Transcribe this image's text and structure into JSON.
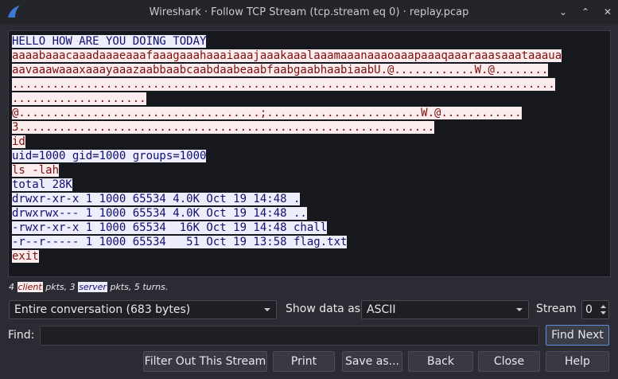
{
  "window": {
    "title": "Wireshark · Follow TCP Stream (tcp.stream eq 0) · replay.pcap",
    "buttons": [
      "⌄",
      "⌃",
      "✕"
    ]
  },
  "stream": {
    "lines": [
      {
        "dir": "server",
        "text": "HELLO HOW ARE YOU DOING TODAY"
      },
      {
        "dir": "client",
        "text": "aaaabaaacaaadaaaeaaafaaagaaahaaaiaaajaaakaaalaaamaaanaaaoaaapaaaqaaaraaasaaataaaua"
      },
      {
        "dir": "client",
        "text": "aavaaawaaaxaaayaaazaabbaabcaabdaabeaabfaabgaabhaabiaabU.@............W.@........"
      },
      {
        "dir": "client",
        "text": "................................................................................."
      },
      {
        "dir": "client",
        "text": "...................."
      },
      {
        "dir": "client",
        "text": "@....................................;.......................W.@............"
      },
      {
        "dir": "client",
        "text": "3.............................................................."
      },
      {
        "dir": "client",
        "text": "id"
      },
      {
        "dir": "server",
        "text": "uid=1000 gid=1000 groups=1000"
      },
      {
        "dir": "client",
        "text": "ls -lah"
      },
      {
        "dir": "server",
        "text": "total 28K"
      },
      {
        "dir": "server",
        "text": "drwxr-xr-x 1 1000 65534 4.0K Oct 19 14:48 ."
      },
      {
        "dir": "server",
        "text": "drwxrwx--- 1 1000 65534 4.0K Oct 19 14:48 .."
      },
      {
        "dir": "server",
        "text": "-rwxr-xr-x 1 1000 65534  16K Oct 19 14:48 chall"
      },
      {
        "dir": "server",
        "text": "-r--r----- 1 1000 65534   51 Oct 19 13:58 flag.txt"
      },
      {
        "dir": "client",
        "text": "exit"
      }
    ]
  },
  "stats": {
    "client_count": "4",
    "client_label": "client",
    "client_suffix": "pkts, 3",
    "server_label": "server",
    "server_suffix": "pkts, 5 turns."
  },
  "controls": {
    "conversation_select": "Entire conversation (683 bytes)",
    "show_data_label": "Show data as",
    "show_data_select": "ASCII",
    "stream_label": "Stream",
    "stream_value": "0",
    "find_label": "Find:",
    "find_value": "",
    "find_next_label": "Find Next"
  },
  "buttons": {
    "filter_out": "Filter Out This Stream",
    "print": "Print",
    "save_as": "Save as...",
    "back": "Back",
    "close": "Close",
    "help": "Help"
  },
  "colors": {
    "client_bg": "#fbeded",
    "client_fg": "#7f0c0c",
    "server_bg": "#ededfb",
    "server_fg": "#10106f",
    "window_bg": "#2b2c33",
    "accent": "#5f8bd8"
  }
}
